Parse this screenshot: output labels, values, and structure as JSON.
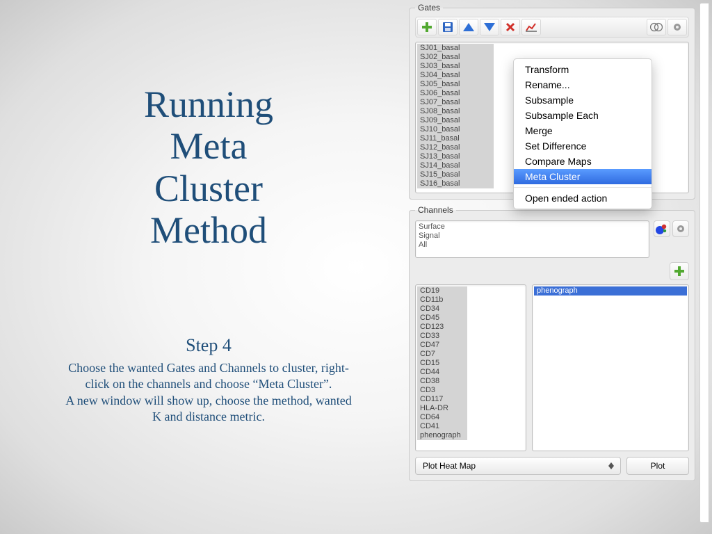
{
  "title_lines": [
    "Running",
    "Meta",
    "Cluster",
    "Method"
  ],
  "step": {
    "heading": "Step 4",
    "body1": "Choose the wanted Gates and Channels to cluster, right-click on the channels and choose “Meta Cluster”.",
    "body2": "A new window will show up, choose the method, wanted K and distance metric."
  },
  "gates": {
    "legend": "Gates",
    "items": [
      "SJ01_basal",
      "SJ02_basal",
      "SJ03_basal",
      "SJ04_basal",
      "SJ05_basal",
      "SJ06_basal",
      "SJ07_basal",
      "SJ08_basal",
      "SJ09_basal",
      "SJ10_basal",
      "SJ11_basal",
      "SJ12_basal",
      "SJ13_basal",
      "SJ14_basal",
      "SJ15_basal",
      "SJ16_basal"
    ]
  },
  "channels": {
    "legend": "Channels",
    "presets": [
      "Surface",
      "Signal",
      "All"
    ],
    "left": [
      "CD19",
      "CD11b",
      "CD34",
      "CD45",
      "CD123",
      "CD33",
      "CD47",
      "CD7",
      "CD15",
      "CD44",
      "CD38",
      "CD3",
      "CD117",
      "HLA-DR",
      "CD64",
      "CD41",
      "phenograph"
    ],
    "right": [
      "phenograph"
    ]
  },
  "combo": {
    "selected": "Plot Heat Map"
  },
  "plot_button": "Plot",
  "context_menu": {
    "items": [
      "Transform",
      "Rename...",
      "Subsample",
      "Subsample Each",
      "Merge",
      "Set Difference",
      "Compare Maps",
      "Meta Cluster"
    ],
    "items_after_sep": [
      "Open ended action"
    ],
    "highlighted": "Meta Cluster"
  }
}
